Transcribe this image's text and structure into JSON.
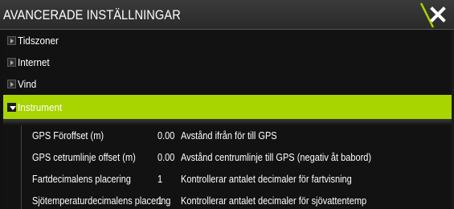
{
  "dialog": {
    "title": "AVANCERADE INSTÄLLNINGAR",
    "accent_color": "#a8d400",
    "close_icon": "close-icon"
  },
  "tree": [
    {
      "label": "Tidszoner",
      "expanded": false
    },
    {
      "label": "Internet",
      "expanded": false
    },
    {
      "label": "Vind",
      "expanded": false
    },
    {
      "label": "Instrument",
      "expanded": true,
      "selected": true
    }
  ],
  "instrument_settings": [
    {
      "name": "GPS Föroffset (m)",
      "value": "0.00",
      "description": "Avstånd ifrån för till GPS"
    },
    {
      "name": "GPS cetrumlinje offset (m)",
      "value": "0.00",
      "description": "Avstånd centrumlinje till GPS (negativ åt babord)"
    },
    {
      "name": "Fartdecimalens placering",
      "value": "1",
      "description": "Kontrollerar antalet decimaler för fartvisning"
    },
    {
      "name": "Sjötemperaturdecimalens placering",
      "value": "1",
      "description": "Kontrollerar antalet decimaler för sjövattentemp"
    }
  ]
}
